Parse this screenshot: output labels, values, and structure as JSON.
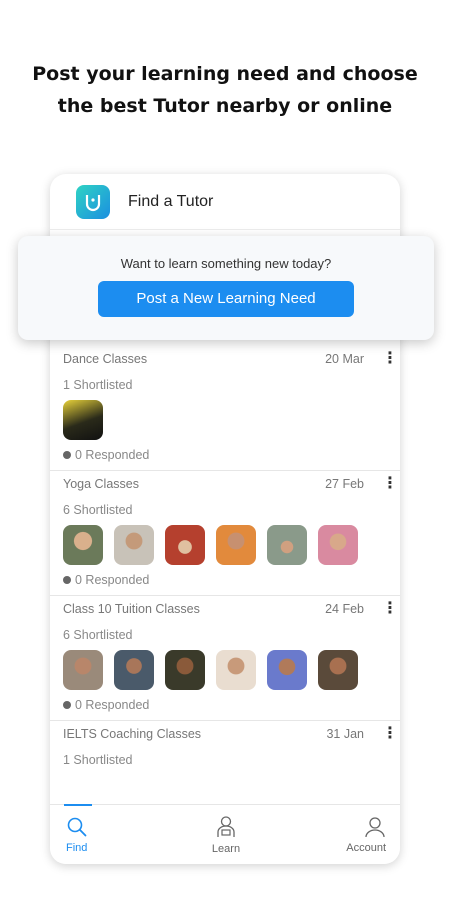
{
  "headline": {
    "line1": "Post your learning need and choose",
    "line2": "the best Tutor nearby or online"
  },
  "appbar": {
    "title": "Find a Tutor"
  },
  "popup": {
    "prompt": "Want to learn something new today?",
    "button_label": "Post a New Learning Need"
  },
  "requests": [
    {
      "title": "Dance Classes",
      "date": "20 Mar",
      "shortlisted": "1 Shortlisted",
      "responded": "0 Responded",
      "avatar_colors": [
        "#3a3a1e"
      ]
    },
    {
      "title": "Yoga Classes",
      "date": "27 Feb",
      "shortlisted": "6 Shortlisted",
      "responded": "0 Responded",
      "avatar_colors": [
        "#6b7a5a",
        "#c8c2b8",
        "#b5402e",
        "#e28a3c",
        "#8a9a8a",
        "#d98aa0"
      ]
    },
    {
      "title": "Class 10 Tuition Classes",
      "date": "24 Feb",
      "shortlisted": "6 Shortlisted",
      "responded": "0 Responded",
      "avatar_colors": [
        "#9a8a7a",
        "#4a5a6a",
        "#3a3a2a",
        "#c9b9a9",
        "#6a7acc",
        "#5a4a3a"
      ]
    },
    {
      "title": "IELTS Coaching Classes",
      "date": "31 Jan",
      "shortlisted": "1 Shortlisted"
    }
  ],
  "nav": {
    "find": "Find",
    "learn": "Learn",
    "account": "Account"
  },
  "colors": {
    "accent": "#1c8df0"
  }
}
